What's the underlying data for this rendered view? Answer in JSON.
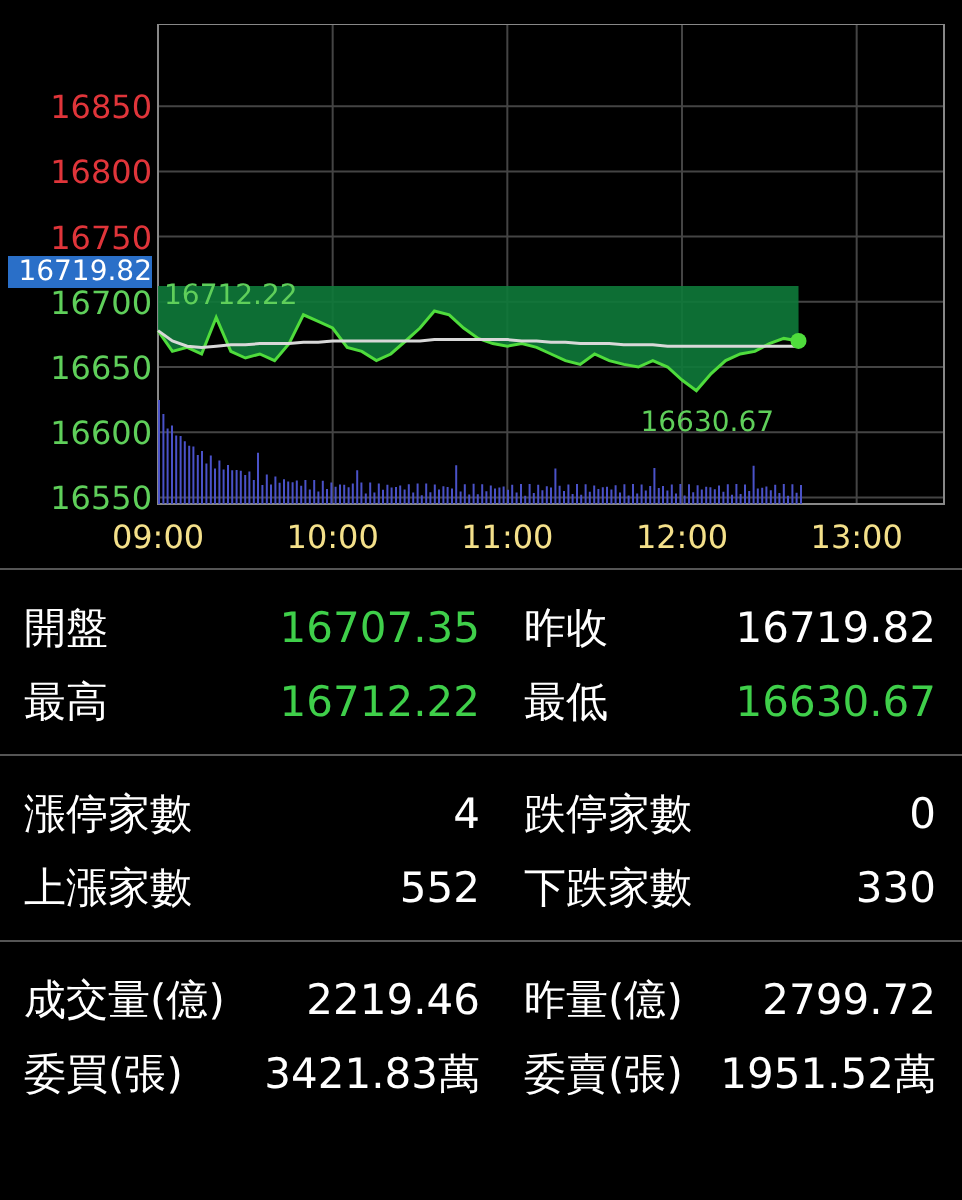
{
  "chart": {
    "reference": {
      "label": "16719.82"
    },
    "chart_data": {
      "type": "line",
      "xlim": [
        9,
        13.5
      ],
      "ylim": [
        16545,
        16913
      ],
      "xticks": [
        {
          "value": 9,
          "label": "09:00"
        },
        {
          "value": 10,
          "label": "10:00"
        },
        {
          "value": 11,
          "label": "11:00"
        },
        {
          "value": 12,
          "label": "12:00"
        },
        {
          "value": 13,
          "label": "13:00"
        }
      ],
      "yticks": [
        16550,
        16600,
        16650,
        16700,
        16750,
        16800,
        16850
      ],
      "x": [
        9,
        9.083,
        9.167,
        9.25,
        9.333,
        9.417,
        9.5,
        9.583,
        9.667,
        9.75,
        9.833,
        9.917,
        10,
        10.083,
        10.167,
        10.25,
        10.333,
        10.417,
        10.5,
        10.583,
        10.667,
        10.75,
        10.833,
        10.917,
        11,
        11.083,
        11.167,
        11.25,
        11.333,
        11.417,
        11.5,
        11.583,
        11.667,
        11.75,
        11.833,
        11.917,
        12,
        12.083,
        12.167,
        12.25,
        12.333,
        12.417,
        12.5,
        12.583,
        12.667
      ],
      "series": [
        {
          "color": "#4fdc3c",
          "values": [
            16678,
            16662,
            16665,
            16660,
            16688,
            16662,
            16657,
            16660,
            16655,
            16668,
            16690,
            16685,
            16680,
            16665,
            16662,
            16655,
            16660,
            16670,
            16680,
            16693,
            16690,
            16680,
            16672,
            16668,
            16666,
            16668,
            16665,
            16660,
            16655,
            16652,
            16660,
            16655,
            16652,
            16650,
            16655,
            16650,
            16640,
            16632,
            16645,
            16655,
            16660,
            16662,
            16668,
            16672,
            16670
          ]
        },
        {
          "color": "#d8d8d8",
          "values": [
            16678,
            16670,
            16666,
            16665,
            16666,
            16667,
            16667,
            16668,
            16668,
            16668,
            16669,
            16669,
            16670,
            16670,
            16670,
            16670,
            16670,
            16670,
            16670,
            16671,
            16671,
            16671,
            16671,
            16671,
            16671,
            16670,
            16670,
            16669,
            16669,
            16668,
            16668,
            16668,
            16667,
            16667,
            16667,
            16666,
            16666,
            16666,
            16666,
            16666,
            16666,
            16666,
            16666,
            16666,
            16666
          ]
        }
      ],
      "annotations": [
        "16712.22",
        "16630.67"
      ]
    }
  },
  "stats": [
    {
      "rows": [
        [
          {
            "label": "開盤",
            "value": "16707.35",
            "color": "#3fcf4a"
          },
          {
            "label": "昨收",
            "value": "16719.82",
            "color": "#ffffff"
          }
        ],
        [
          {
            "label": "最高",
            "value": "16712.22",
            "color": "#3fcf4a"
          },
          {
            "label": "最低",
            "value": "16630.67",
            "color": "#3fcf4a"
          }
        ]
      ]
    },
    {
      "rows": [
        [
          {
            "label": "漲停家數",
            "value": "4",
            "color": "#ffffff"
          },
          {
            "label": "跌停家數",
            "value": "0",
            "color": "#ffffff"
          }
        ],
        [
          {
            "label": "上漲家數",
            "value": "552",
            "color": "#ffffff"
          },
          {
            "label": "下跌家數",
            "value": "330",
            "color": "#ffffff"
          }
        ]
      ]
    },
    {
      "rows": [
        [
          {
            "label": "成交量(億)",
            "value": "2219.46",
            "color": "#ffffff"
          },
          {
            "label": "昨量(億)",
            "value": "2799.72",
            "color": "#ffffff"
          }
        ],
        [
          {
            "label": "委買(張)",
            "value": "3421.83萬",
            "color": "#ffffff"
          },
          {
            "label": "委賣(張)",
            "value": "1951.52萬",
            "color": "#ffffff"
          }
        ]
      ]
    }
  ]
}
